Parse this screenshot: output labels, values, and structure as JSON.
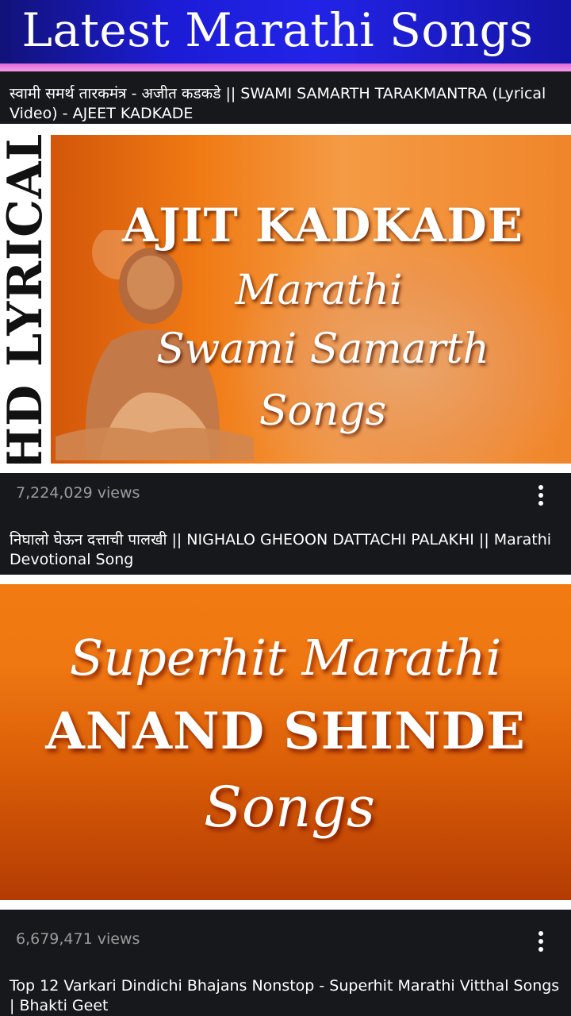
{
  "header": {
    "title": "Latest Marathi Songs"
  },
  "videos": [
    {
      "title": "स्वामी समर्थ तारकमंत्र - अजीत कडकडे || SWAMI SAMARTH TARAKMANTRA (Lyrical Video) - AJEET KADKADE",
      "thumbnail": {
        "band": "HD LYRICAL",
        "line1": "AJIT KADKADE",
        "line2": "Marathi",
        "line3": "Swami Samarth",
        "line4": "Songs"
      },
      "views": "7,224,029 views",
      "menu_icon": "more-vert-icon"
    },
    {
      "title": "निघालो घेऊन दत्ताची पालखी || NIGHALO GHEOON DATTACHI PALAKHI || Marathi Devotional Song",
      "thumbnail": {
        "line1": "Superhit Marathi",
        "line2": "ANAND SHINDE",
        "line3": "Songs"
      },
      "views": "6,679,471 views",
      "menu_icon": "more-vert-icon"
    },
    {
      "title": "Top 12 Varkari Dindichi Bhajans Nonstop - Superhit Marathi Vitthal Songs | Bhakti Geet"
    }
  ],
  "colors": {
    "header_blue": "#1c1cd6",
    "accent_pink": "#e26bd7",
    "card_dark": "#17181c",
    "views_gray": "#9b9b9b"
  }
}
